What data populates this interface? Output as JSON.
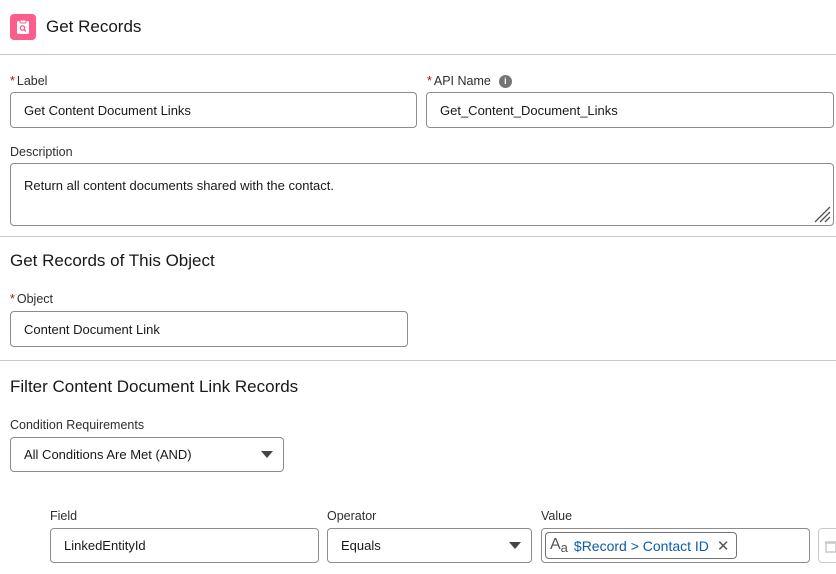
{
  "header": {
    "title": "Get Records",
    "icon": "get-records-icon",
    "icon_color": "#fe5c8b"
  },
  "label": {
    "label": "Label",
    "value": "Get Content Document Links"
  },
  "api_name": {
    "label": "API Name",
    "value": "Get_Content_Document_Links"
  },
  "description": {
    "label": "Description",
    "value": "Return all content documents shared with the contact."
  },
  "object_section": {
    "heading": "Get Records of This Object",
    "object_label": "Object",
    "object_value": "Content Document Link"
  },
  "filter_section": {
    "heading": "Filter Content Document Link Records",
    "condition_label": "Condition Requirements",
    "condition_value": "All Conditions Are Met (AND)"
  },
  "condition_row": {
    "field_label": "Field",
    "field_value": "LinkedEntityId",
    "operator_label": "Operator",
    "operator_value": "Equals",
    "value_label": "Value",
    "value_pill": "$Record > Contact ID"
  }
}
